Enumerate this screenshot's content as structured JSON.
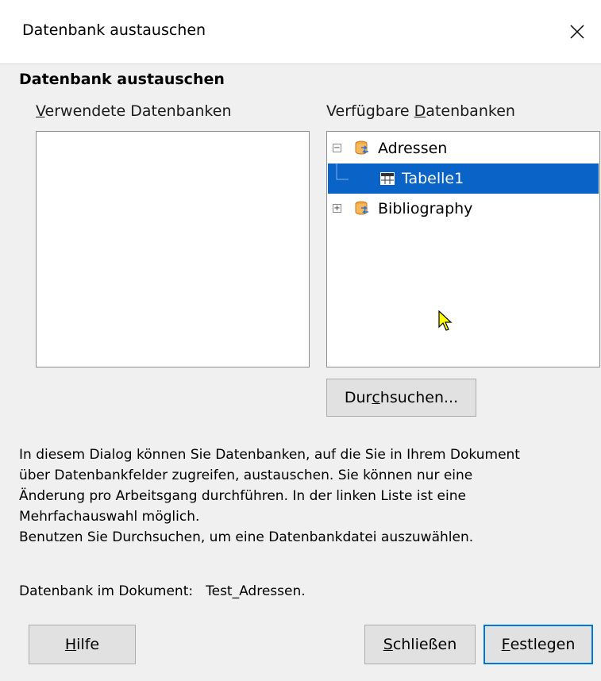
{
  "window": {
    "title": "Datenbank austauschen"
  },
  "section": {
    "title": "Datenbank austauschen"
  },
  "used": {
    "label_pre": "",
    "label_acc": "V",
    "label_post": "erwendete Datenbanken"
  },
  "available": {
    "label_pre": "Verfügbare ",
    "label_acc": "D",
    "label_post": "atenbanken",
    "tree": [
      {
        "label": "Adressen",
        "icon": "database-icon",
        "expander": "minus"
      },
      {
        "label": "Tabelle1",
        "icon": "table-icon",
        "selected": true
      },
      {
        "label": "Bibliography",
        "icon": "database-icon",
        "expander": "plus"
      }
    ]
  },
  "browse": {
    "pre": "Dur",
    "acc": "c",
    "post": "hsuchen..."
  },
  "description": [
    "In diesem Dialog können Sie Datenbanken, auf die Sie in Ihrem Dokument",
    "über Datenbankfelder zugreifen, austauschen. Sie können nur eine",
    "Änderung pro Arbeitsgang durchführen. In der linken Liste ist eine",
    "Mehrfachauswahl möglich.",
    "Benutzen Sie Durchsuchen, um eine Datenbankdatei auszuwählen."
  ],
  "document_db": {
    "label": "Datenbank im Dokument:",
    "value": "Test_Adressen."
  },
  "buttons": {
    "help": {
      "acc": "H",
      "post": "ilfe"
    },
    "close": {
      "acc": "S",
      "post": "chließen"
    },
    "apply": {
      "acc": "F",
      "post": "estlegen"
    }
  },
  "colors": {
    "selection": "#0a64c8",
    "default_border": "#0078d7"
  }
}
